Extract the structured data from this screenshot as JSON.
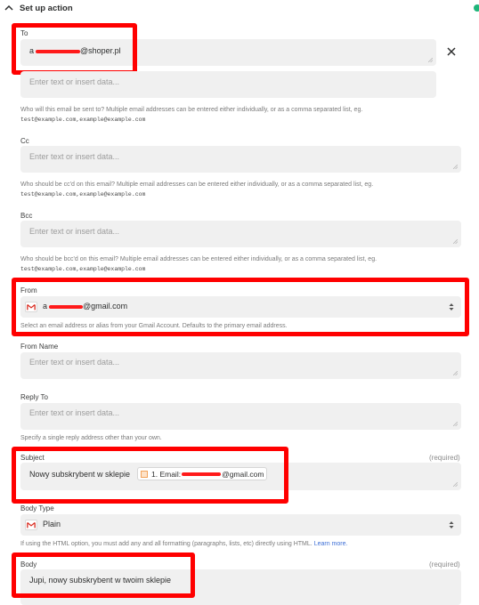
{
  "header": {
    "title": "Set up action"
  },
  "to": {
    "label": "To",
    "value_suffix": "@shoper.pl",
    "value_prefix": "a",
    "placeholder": "Enter text or insert data...",
    "help": "Who will this email be sent to? Multiple email addresses can be entered either individually, or as a comma separated list, eg.",
    "example": "test@example.com,example@example.com"
  },
  "cc": {
    "label": "Cc",
    "placeholder": "Enter text or insert data...",
    "help": "Who should be cc'd on this email? Multiple email addresses can be entered either individually, or as a comma separated list, eg.",
    "example": "test@example.com,example@example.com"
  },
  "bcc": {
    "label": "Bcc",
    "placeholder": "Enter text or insert data...",
    "help": "Who should be bcc'd on this email? Multiple email addresses can be entered either individually, or as a comma separated list, eg.",
    "example": "test@example.com,example@example.com"
  },
  "from": {
    "label": "From",
    "value_prefix": "a",
    "value_suffix": "@gmail.com",
    "help": "Select an email address or alias from your Gmail Account. Defaults to the primary email address."
  },
  "from_name": {
    "label": "From Name",
    "placeholder": "Enter text or insert data..."
  },
  "reply_to": {
    "label": "Reply To",
    "placeholder": "Enter text or insert data...",
    "help": "Specify a single reply address other than your own."
  },
  "subject": {
    "label": "Subject",
    "required": "(required)",
    "text": "Nowy subskrybent w sklepie",
    "chip_prefix": "1. Email: ",
    "chip_suffix": "@gmail.com"
  },
  "body_type": {
    "label": "Body Type",
    "value": "Plain",
    "help": "If using the HTML option, you must add any and all formatting (paragraphs, lists, etc) directly using HTML.",
    "link": "Learn more."
  },
  "body": {
    "label": "Body",
    "required": "(required)",
    "text": "Jupi, nowy subskrybent w twoim sklepie"
  }
}
